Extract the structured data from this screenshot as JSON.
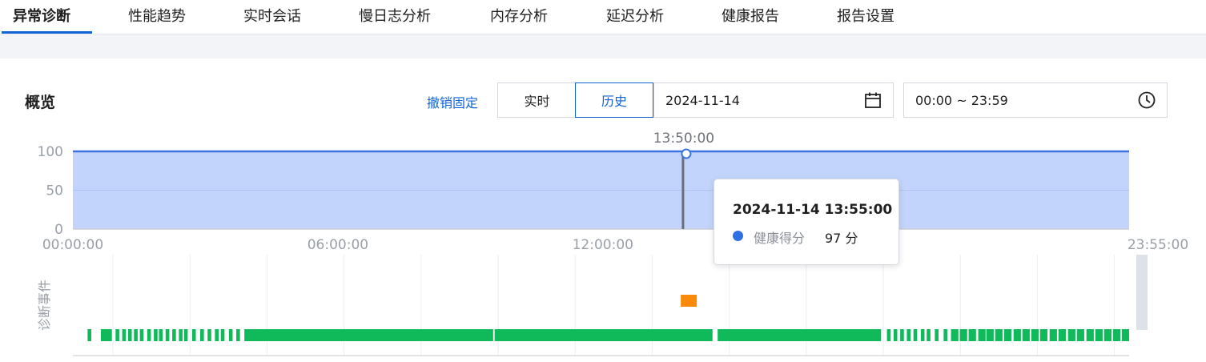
{
  "nav": {
    "tabs": [
      {
        "label": "异常诊断",
        "active": true
      },
      {
        "label": "性能趋势"
      },
      {
        "label": "实时会话"
      },
      {
        "label": "慢日志分析"
      },
      {
        "label": "内存分析"
      },
      {
        "label": "延迟分析"
      },
      {
        "label": "健康报告"
      },
      {
        "label": "报告设置"
      }
    ]
  },
  "overview": {
    "title": "概览",
    "unpin_label": "撤销固定",
    "mode": {
      "realtime_label": "实时",
      "history_label": "历史",
      "selected": "history"
    },
    "date_value": "2024-11-14",
    "time_range_value": "00:00 ~ 23:59",
    "icons": {
      "date": "calendar-icon",
      "time": "clock-icon"
    }
  },
  "colors": {
    "accent": "#1264d6",
    "area_fill": "#c2d4fb",
    "line": "#3b74e0",
    "normal_event": "#10b95a",
    "warning_event": "#fa8a0c"
  },
  "chart_data": {
    "type": "area",
    "series": [
      {
        "name": "健康得分",
        "values": [
          100,
          100
        ]
      }
    ],
    "x": [
      "00:00:00",
      "23:55:00"
    ],
    "x_ticks": [
      "00:00:00",
      "06:00:00",
      "12:00:00",
      "23:55:00"
    ],
    "y_ticks": [
      100,
      50,
      0
    ],
    "ylim": [
      0,
      100
    ],
    "pinned_marker_label": "13:50:00",
    "pinned_marker_value": 100,
    "events_axis_label": "诊断事件",
    "normal_event_ranges": [
      [
        "00:20",
        "00:25"
      ],
      [
        "00:38",
        "00:53"
      ],
      [
        "00:58",
        "01:03"
      ],
      [
        "01:07",
        "01:12"
      ],
      [
        "01:15",
        "01:20"
      ],
      [
        "01:23",
        "01:28"
      ],
      [
        "01:31",
        "01:36"
      ],
      [
        "01:41",
        "01:46"
      ],
      [
        "01:50",
        "01:55"
      ],
      [
        "01:57",
        "02:02"
      ],
      [
        "02:06",
        "02:11"
      ],
      [
        "02:15",
        "02:20"
      ],
      [
        "02:24",
        "02:29"
      ],
      [
        "02:31",
        "02:36"
      ],
      [
        "02:42",
        "02:47"
      ],
      [
        "02:53",
        "02:58"
      ],
      [
        "03:03",
        "03:08"
      ],
      [
        "03:13",
        "03:18"
      ],
      [
        "03:21",
        "03:26"
      ],
      [
        "03:32",
        "03:37"
      ],
      [
        "03:42",
        "03:47"
      ],
      [
        "03:53",
        "04:38"
      ],
      [
        "04:38",
        "09:31"
      ],
      [
        "09:33",
        "14:29"
      ],
      [
        "14:36",
        "18:18"
      ],
      [
        "18:26",
        "18:31"
      ],
      [
        "18:35",
        "18:40"
      ],
      [
        "18:44",
        "18:49"
      ],
      [
        "18:53",
        "18:58"
      ],
      [
        "19:02",
        "19:07"
      ],
      [
        "19:12",
        "19:17"
      ],
      [
        "19:20",
        "19:25"
      ],
      [
        "19:31",
        "19:36"
      ],
      [
        "19:43",
        "19:48"
      ],
      [
        "19:53",
        "20:03"
      ],
      [
        "20:05",
        "20:15"
      ],
      [
        "20:17",
        "20:27"
      ],
      [
        "20:30",
        "20:40"
      ],
      [
        "20:41",
        "20:51"
      ],
      [
        "20:53",
        "21:03"
      ],
      [
        "21:05",
        "21:15"
      ],
      [
        "21:18",
        "21:28"
      ],
      [
        "21:30",
        "21:40"
      ],
      [
        "21:42",
        "21:52"
      ],
      [
        "21:54",
        "22:04"
      ],
      [
        "22:07",
        "22:17"
      ],
      [
        "22:19",
        "22:29"
      ],
      [
        "22:32",
        "22:42"
      ],
      [
        "22:44",
        "22:54"
      ],
      [
        "22:57",
        "23:07"
      ],
      [
        "23:09",
        "23:19"
      ],
      [
        "23:21",
        "23:31"
      ],
      [
        "23:33",
        "23:43"
      ],
      [
        "23:45",
        "23:55"
      ]
    ],
    "warning_event_times": [
      "14:00"
    ]
  },
  "tooltip": {
    "title": "2024-11-14 13:55:00",
    "series_label": "健康得分",
    "value": "97 分"
  }
}
